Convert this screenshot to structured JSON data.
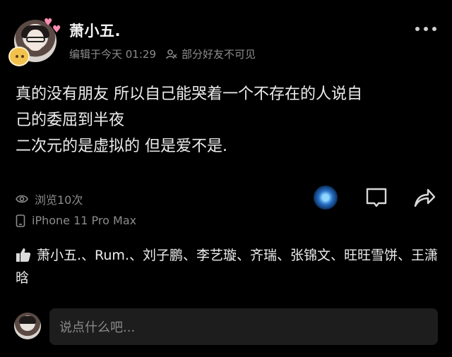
{
  "post": {
    "username": "萧小五.",
    "edited_time": "编辑于今天 01:29",
    "visibility": "部分好友不可见",
    "content": "真的没有朋友 所以自己能哭着一个不存在的人说自\n己的委屈到半夜\n二次元的是虚拟的 但是爱不是.",
    "views": "浏览10次",
    "device": "iPhone 11 Pro Max"
  },
  "likes": {
    "names": "萧小五.、Rum.、刘子鹏、李艺璇、齐瑞、张锦文、旺旺雪饼、王潇晗"
  },
  "comment": {
    "placeholder": "说点什么吧..."
  },
  "icons": {
    "more": "more-dots-icon",
    "visibility": "people-icon",
    "views": "eye-icon",
    "device": "phone-icon",
    "reward": "reward-badge-icon",
    "comment": "comment-icon",
    "share": "share-icon",
    "like": "thumbs-up-icon"
  },
  "colors": {
    "background": "#000000",
    "text": "#ededed",
    "muted": "#8c8c8c",
    "input_bg": "#1d1d1d"
  }
}
